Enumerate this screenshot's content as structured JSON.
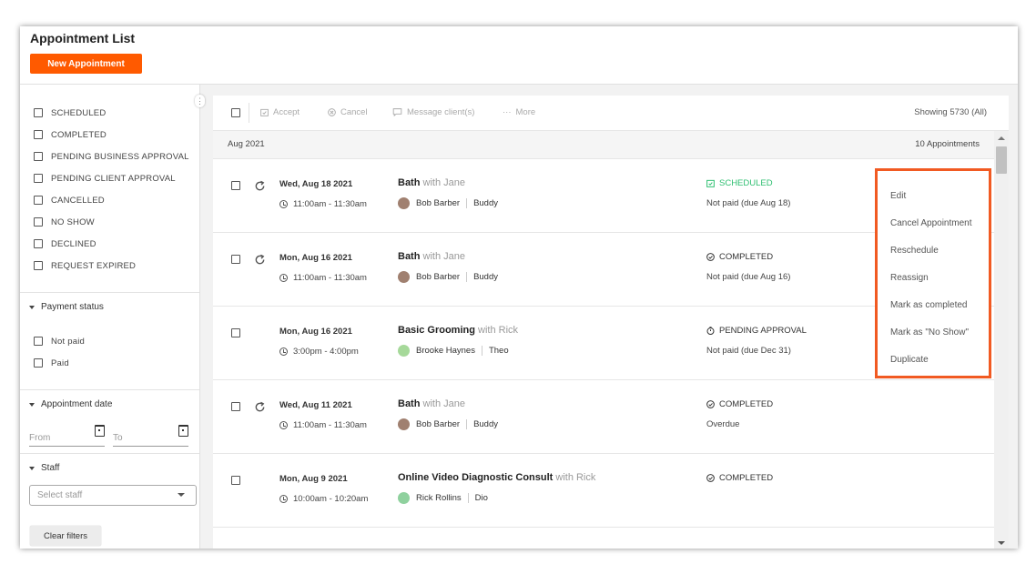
{
  "header": {
    "title": "Appointment List",
    "new_button": "New Appointment"
  },
  "sidebar": {
    "statuses": [
      "SCHEDULED",
      "COMPLETED",
      "PENDING BUSINESS APPROVAL",
      "PENDING CLIENT APPROVAL",
      "CANCELLED",
      "NO SHOW",
      "DECLINED",
      "REQUEST EXPIRED"
    ],
    "payment_title": "Payment status",
    "payment_options": [
      "Not paid",
      "Paid"
    ],
    "date_title": "Appointment date",
    "from_placeholder": "From",
    "to_placeholder": "To",
    "staff_title": "Staff",
    "staff_placeholder": "Select staff",
    "clear_label": "Clear filters"
  },
  "toolbar": {
    "accept": "Accept",
    "cancel": "Cancel",
    "message": "Message client(s)",
    "more": "More",
    "showing": "Showing 5730 (All)"
  },
  "group": {
    "label": "Aug 2021",
    "count": "10 Appointments"
  },
  "appointments": [
    {
      "date": "Wed, Aug 18 2021",
      "time": "11:00am - 11:30am",
      "service": "Bath",
      "with": "with Jane",
      "client": "Bob Barber",
      "pet": "Buddy",
      "status": "SCHEDULED",
      "payment": "Not paid (due Aug 18)"
    },
    {
      "date": "Mon, Aug 16 2021",
      "time": "11:00am - 11:30am",
      "service": "Bath",
      "with": "with Jane",
      "client": "Bob Barber",
      "pet": "Buddy",
      "status": "COMPLETED",
      "payment": "Not paid (due Aug 16)"
    },
    {
      "date": "Mon, Aug 16 2021",
      "time": "3:00pm - 4:00pm",
      "service": "Basic Grooming",
      "with": "with Rick",
      "client": "Brooke Haynes",
      "pet": "Theo",
      "status": "PENDING APPROVAL",
      "payment": "Not paid (due Dec 31)"
    },
    {
      "date": "Wed, Aug 11 2021",
      "time": "11:00am - 11:30am",
      "service": "Bath",
      "with": "with Jane",
      "client": "Bob Barber",
      "pet": "Buddy",
      "status": "COMPLETED",
      "payment": "Overdue"
    },
    {
      "date": "Mon, Aug 9 2021",
      "time": "10:00am - 10:20am",
      "service": "Online Video Diagnostic Consult",
      "with": "with Rick",
      "client": "Rick Rollins",
      "pet": "Dio",
      "status": "COMPLETED",
      "payment": ""
    }
  ],
  "context_menu": [
    "Edit",
    "Cancel Appointment",
    "Reschedule",
    "Reassign",
    "Mark as completed",
    "Mark as \"No Show\"",
    "Duplicate"
  ],
  "colors": {
    "brand_orange": "#ff5a00",
    "menu_border": "#f15a22",
    "scheduled_green": "#2fbf71"
  }
}
